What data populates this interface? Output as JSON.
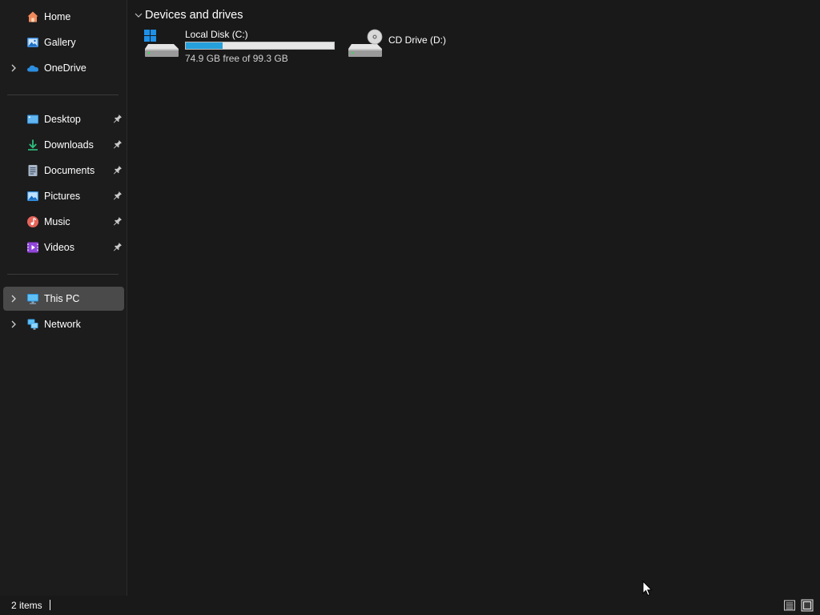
{
  "sidebar": {
    "items": [
      {
        "label": "Home",
        "icon": "home-icon",
        "has_chevron": false,
        "pinned": false,
        "selected": false
      },
      {
        "label": "Gallery",
        "icon": "gallery-icon",
        "has_chevron": false,
        "pinned": false,
        "selected": false
      },
      {
        "label": "OneDrive",
        "icon": "onedrive-icon",
        "has_chevron": true,
        "pinned": false,
        "selected": false
      },
      {
        "label": "Desktop",
        "icon": "desktop-icon",
        "has_chevron": false,
        "pinned": true,
        "selected": false
      },
      {
        "label": "Downloads",
        "icon": "downloads-icon",
        "has_chevron": false,
        "pinned": true,
        "selected": false
      },
      {
        "label": "Documents",
        "icon": "documents-icon",
        "has_chevron": false,
        "pinned": true,
        "selected": false
      },
      {
        "label": "Pictures",
        "icon": "pictures-icon",
        "has_chevron": false,
        "pinned": true,
        "selected": false
      },
      {
        "label": "Music",
        "icon": "music-icon",
        "has_chevron": false,
        "pinned": true,
        "selected": false
      },
      {
        "label": "Videos",
        "icon": "videos-icon",
        "has_chevron": false,
        "pinned": true,
        "selected": false
      },
      {
        "label": "This PC",
        "icon": "this-pc-icon",
        "has_chevron": true,
        "pinned": false,
        "selected": true
      },
      {
        "label": "Network",
        "icon": "network-icon",
        "has_chevron": true,
        "pinned": false,
        "selected": false
      }
    ]
  },
  "content": {
    "group_title": "Devices and drives",
    "drives": [
      {
        "name": "Local Disk (C:)",
        "icon": "local-disk-icon",
        "free_text": "74.9 GB free of 99.3 GB",
        "used_fraction": 0.246
      },
      {
        "name": "CD Drive (D:)",
        "icon": "cd-drive-icon"
      }
    ]
  },
  "statusbar": {
    "item_count": "2 items"
  },
  "colors": {
    "background": "#191919",
    "sidebar_selected": "#4a4a4a",
    "usage_bar_fill": "#26a0da",
    "usage_bar_track": "#e6e6e6"
  }
}
